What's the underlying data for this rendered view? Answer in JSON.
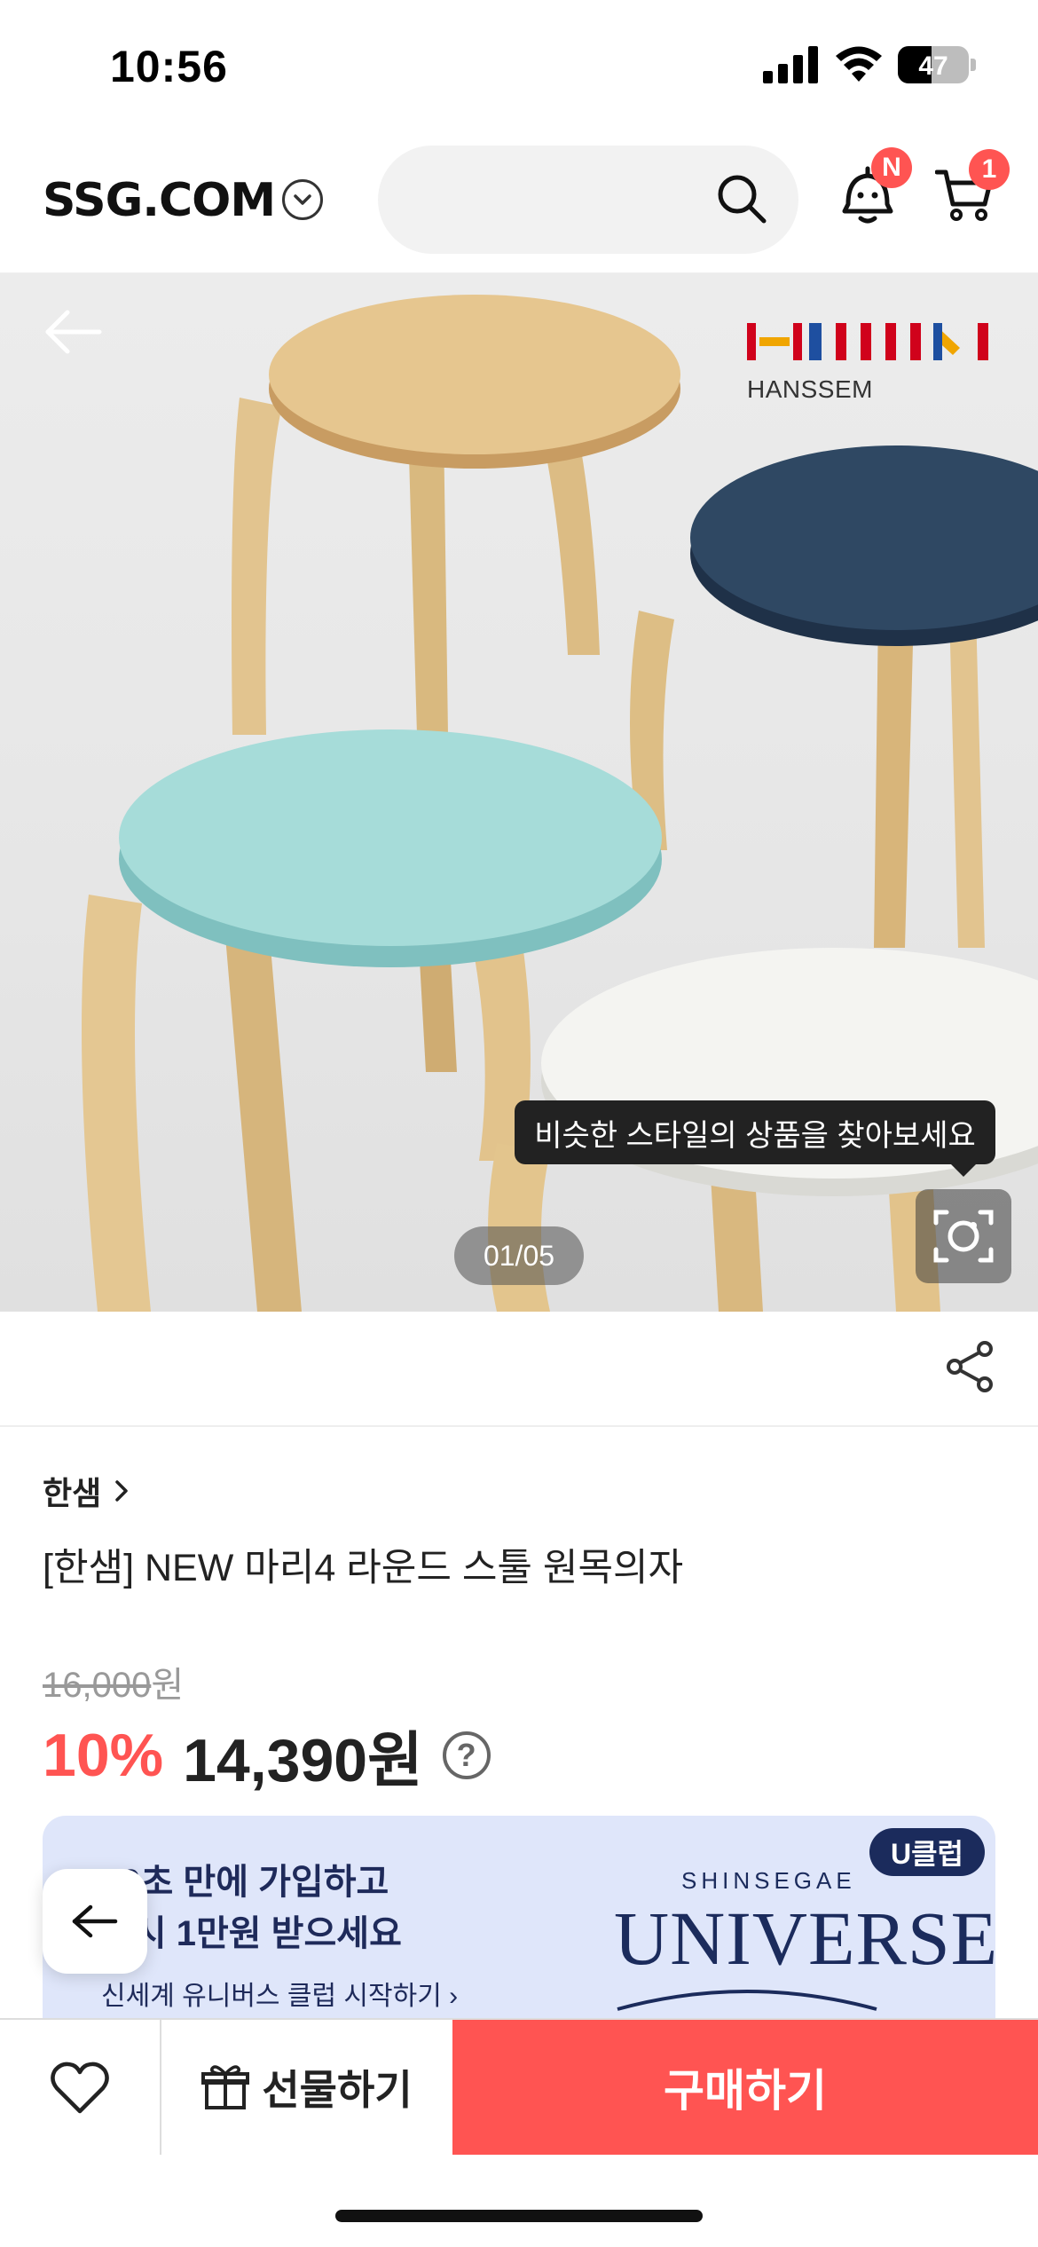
{
  "status_bar": {
    "time": "10:56",
    "battery": "47"
  },
  "header": {
    "logo": "SSG.COM",
    "notification_badge": "N",
    "cart_badge": "1"
  },
  "hero": {
    "brand_name": "HANSSEM",
    "tooltip": "비슷한 스타일의 상품을 찾아보세요",
    "pager": "01/05"
  },
  "product": {
    "brand": "한샘",
    "title": "[한샘] NEW 마리4 라운드 스툴 원목의자",
    "original_price": "16,000",
    "currency": "원",
    "discount": "10%",
    "price": "14,390원"
  },
  "banner": {
    "line1": "10초 만에 가입하고",
    "line2": "즉시 1만원 받으세요",
    "line3": "신세계 유니버스 클럽 시작하기",
    "badge": "U클럽",
    "logo_small": "SHINSEGAE",
    "logo_big": "UNIVERSE"
  },
  "bottom_bar": {
    "gift_label": "선물하기",
    "buy_label": "구매하기"
  },
  "colors": {
    "accent": "#ff5452",
    "navy": "#1b2b5c"
  }
}
